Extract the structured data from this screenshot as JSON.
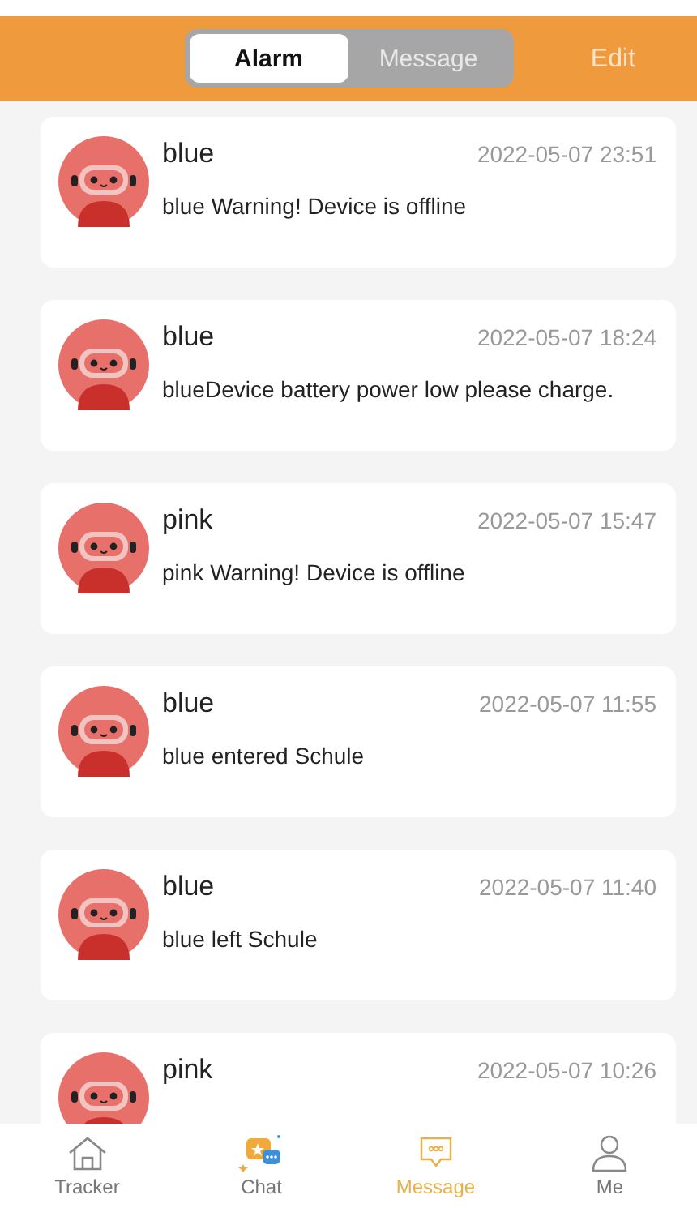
{
  "header": {
    "tabs": [
      {
        "label": "Alarm",
        "selected": true
      },
      {
        "label": "Message",
        "selected": false
      }
    ],
    "edit": "Edit"
  },
  "notifications": [
    {
      "name": "blue",
      "time": "2022-05-07 23:51",
      "message": "blue Warning! Device is offline"
    },
    {
      "name": "blue",
      "time": "2022-05-07 18:24",
      "message": "blueDevice battery power low please charge."
    },
    {
      "name": "pink",
      "time": "2022-05-07 15:47",
      "message": "pink Warning! Device is offline"
    },
    {
      "name": "blue",
      "time": "2022-05-07 11:55",
      "message": "blue entered Schule"
    },
    {
      "name": "blue",
      "time": "2022-05-07 11:40",
      "message": "blue left Schule"
    },
    {
      "name": "pink",
      "time": "2022-05-07 10:26"
    }
  ],
  "bottom_nav": [
    {
      "label": "Tracker",
      "kind": "home",
      "selected": false
    },
    {
      "label": "Chat",
      "kind": "chat",
      "selected": false
    },
    {
      "label": "Message",
      "kind": "message",
      "selected": true
    },
    {
      "label": "Me",
      "kind": "person",
      "selected": false
    }
  ]
}
